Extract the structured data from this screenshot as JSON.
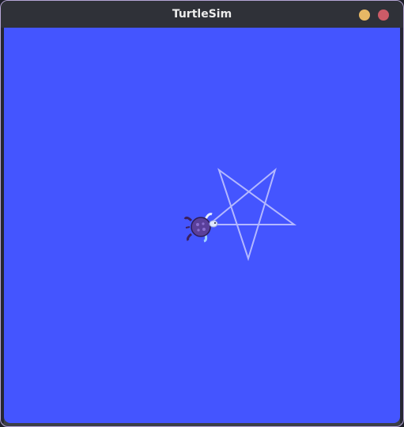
{
  "window": {
    "title": "TurtleSim"
  },
  "colors": {
    "canvas_background": "#4455ff",
    "pen": "#b3b8ff",
    "titlebar": "#2f3138",
    "minimize_button": "#e7b865",
    "close_button": "#cc5b67",
    "turtle_shell": "#5a3f9a",
    "turtle_body": "#4a3070"
  },
  "icons": {
    "minimize": "minimize-icon",
    "close": "close-icon",
    "turtle": "turtle-icon"
  }
}
